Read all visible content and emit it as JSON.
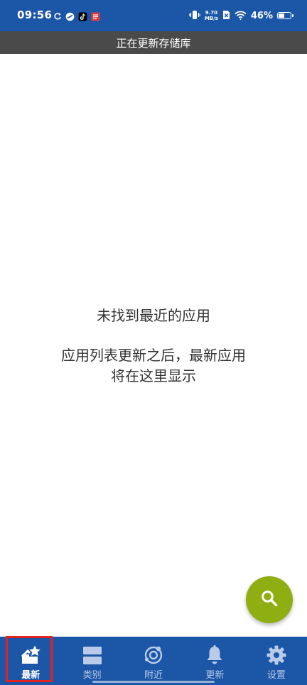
{
  "status_bar": {
    "time": "09:56",
    "net_speed_value": "9.70",
    "net_speed_unit": "MB/s",
    "battery_text": "46%",
    "battery_level": 0.46,
    "left_icons": [
      "sync-icon",
      "app-icon",
      "tiktok-icon",
      "app-notification-icon"
    ],
    "right_icons": [
      "vibrate-icon",
      "sim-blocked-icon",
      "wifi-icon",
      "battery-icon"
    ]
  },
  "banner": {
    "text": "正在更新存储库"
  },
  "empty_state": {
    "title": "未找到最近的应用",
    "line1": "应用列表更新之后，最新应用",
    "line2": "将在这里显示"
  },
  "fab": {
    "icon": "search-icon"
  },
  "bottom_nav": {
    "items": [
      {
        "label": "最新",
        "icon": "new-apps-icon",
        "active": true
      },
      {
        "label": "类别",
        "icon": "categories-icon",
        "active": false
      },
      {
        "label": "附近",
        "icon": "nearby-icon",
        "active": false
      },
      {
        "label": "更新",
        "icon": "bell-icon",
        "active": false
      },
      {
        "label": "设置",
        "icon": "gear-icon",
        "active": false
      }
    ]
  },
  "colors": {
    "primary": "#1c56a7",
    "banner": "#4a4a4a",
    "fab": "#8fae12",
    "highlight": "#e3211e"
  }
}
